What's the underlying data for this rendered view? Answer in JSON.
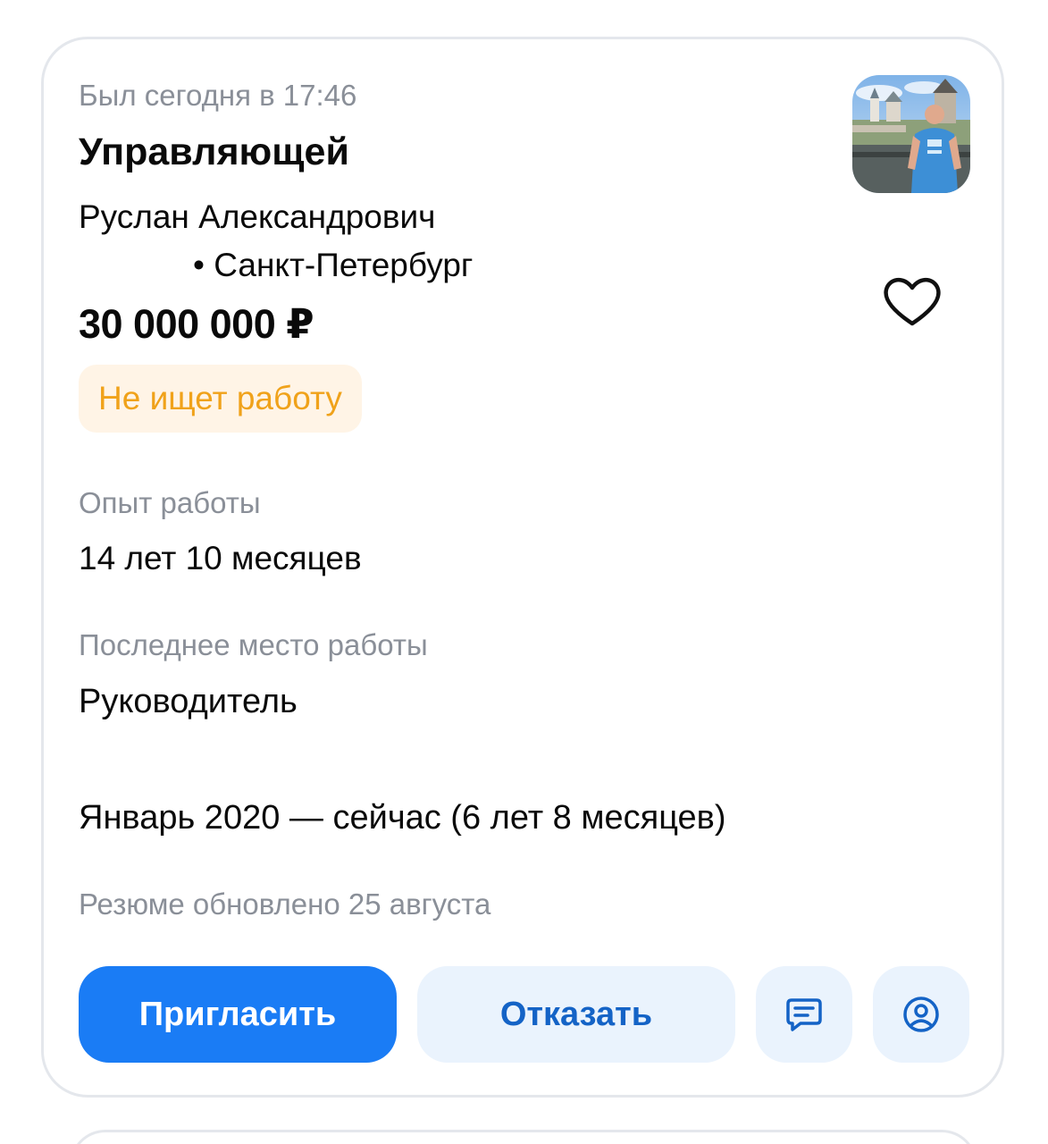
{
  "resume": {
    "last_seen": "Был сегодня в 17:46",
    "title": "Управляющей",
    "name": "Руслан Александрович",
    "location": "• Санкт-Петербург",
    "salary": "30 000 000 ₽",
    "status": "Не ищет работу",
    "experience_label": "Опыт работы",
    "experience_value": "14 лет 10 месяцев",
    "last_job_label": "Последнее место работы",
    "last_job_position": "Руководитель",
    "last_job_period": "Январь 2020 — сейчас (6 лет 8 месяцев)",
    "updated": "Резюме обновлено 25 августа"
  },
  "actions": {
    "invite_label": "Пригласить",
    "reject_label": "Отказать",
    "chat_icon": "chat-icon",
    "profile_icon": "user-circle-icon",
    "favorite_icon": "heart-icon"
  },
  "colors": {
    "accent": "#1a7cf5",
    "accent_soft": "#eaf3fd",
    "status_text": "#f0a21a",
    "status_bg": "#fff4e6",
    "muted_text": "#8a8f98"
  }
}
